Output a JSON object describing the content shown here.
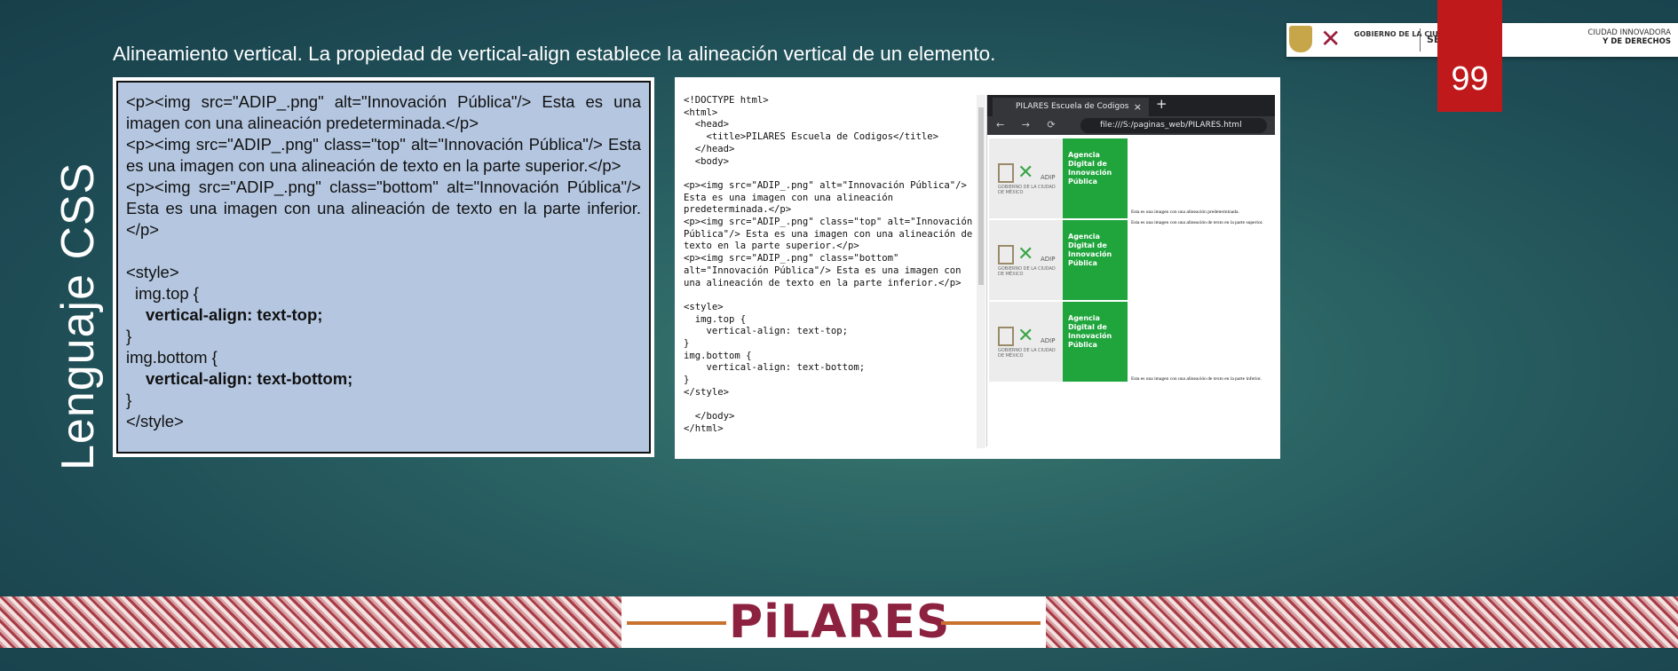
{
  "slide": {
    "vertical_title": "Lenguaje CSS",
    "heading": "Alineamiento vertical. La propiedad de vertical-align establece la alineación vertical de un elemento.",
    "page_number": "99"
  },
  "code_box": {
    "p1": "<p><img src=\"ADIP_.png\" alt=\"Innovación Pública\"/> Esta es una imagen con una alineación predeterminada.</p>",
    "p2": "<p><img src=\"ADIP_.png\" class=\"top\" alt=\"Innovación Pública\"/> Esta es una imagen con una alineación de texto en la parte superior.</p>",
    "p3": "<p><img src=\"ADIP_.png\" class=\"bottom\" alt=\"Innovación Pública\"/> Esta es una imagen con una alineación de texto en la parte inferior.</p>",
    "style_open": "<style>",
    "top_selector": "img.top {",
    "top_rule": "vertical-align: text-top;",
    "close_brace_1": "}",
    "bottom_selector": "img.bottom {",
    "bottom_rule": "vertical-align: text-bottom;",
    "close_brace_2": "}",
    "style_close": "</style>"
  },
  "editor": {
    "code": "<!DOCTYPE html>\n<html>\n  <head>\n    <title>PILARES Escuela de Codigos</title>\n  </head>\n  <body>\n\n<p><img src=\"ADIP_.png\" alt=\"Innovación Pública\"/>\nEsta es una imagen con una alineación\npredeterminada.</p>\n<p><img src=\"ADIP_.png\" class=\"top\" alt=\"Innovación\nPública\"/> Esta es una imagen con una alineación de\ntexto en la parte superior.</p>\n<p><img src=\"ADIP_.png\" class=\"bottom\"\nalt=\"Innovación Pública\"/> Esta es una imagen con\nuna alineación de texto en la parte inferior.</p>\n\n<style>\n  img.top {\n    vertical-align: text-top;\n}\nimg.bottom {\n    vertical-align: text-bottom;\n}\n</style>\n\n  </body>\n</html>"
  },
  "browser": {
    "tab_title": "PILARES Escuela de Codigos",
    "tab_close": "×",
    "new_tab": "+",
    "nav_buttons": "← → ⟳",
    "url": "file:///S:/paginas_web/PILARES.html",
    "ad_green_text": "Agencia Digital de Innovación Pública",
    "ad_logo_text": "GOBIERNO DE LA CIUDAD DE MÉXICO",
    "ad_adip": "ADIP",
    "caption1": "Esta es una imagen con una alineación predeterminada.",
    "caption2": "Esta es una imagen con una alineación de texto en la parte superior.",
    "caption3": "Esta es una imagen con una alineación de texto en la parte inferior."
  },
  "header_logos": {
    "gov_text": "GOBIERNO DE LA CIUDAD DE MÉXICO",
    "sectei": "SECTEI",
    "ciudad_line1": "CIUDAD INNOVADORA",
    "ciudad_line2": "Y DE DERECHOS"
  },
  "footer": {
    "brand": "PiLARES"
  },
  "colors": {
    "accent_red": "#c0191c",
    "pilares_wine": "#8d2140",
    "adip_green": "#1fa53c",
    "code_box_bg": "#b4c6e0"
  }
}
